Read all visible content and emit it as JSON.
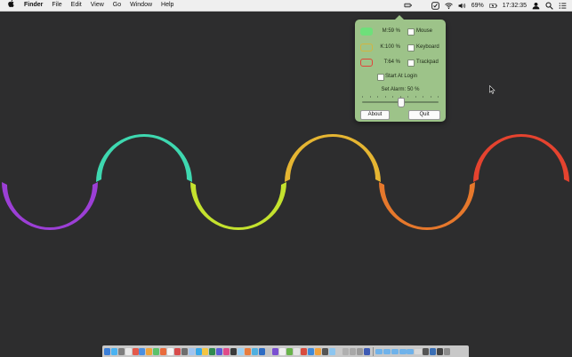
{
  "menubar": {
    "apple_icon": "apple-logo-icon",
    "app_name": "Finder",
    "menus": [
      "File",
      "Edit",
      "View",
      "Go",
      "Window",
      "Help"
    ],
    "status": {
      "icons": [
        "battery-app-icon",
        "checkmark-icon",
        "wifi-icon",
        "volume-icon"
      ],
      "battery_percent": "69%",
      "time": "17:32:35",
      "right_icons": [
        "user-icon",
        "search-icon",
        "list-icon"
      ]
    }
  },
  "popover": {
    "background": "#9dc389",
    "devices": [
      {
        "icon": "mouse-battery-icon",
        "color": "#6ee07a",
        "value": "M:59 %",
        "checkbox_label": "Mouse",
        "checked": false
      },
      {
        "icon": "keyboard-battery-icon",
        "color": "#d2b540",
        "value": "K:100 %",
        "checkbox_label": "Keyboard",
        "checked": false
      },
      {
        "icon": "trackpad-battery-icon",
        "color": "#e0443a",
        "value": "T:64 %",
        "checkbox_label": "Trackpad",
        "checked": false
      }
    ],
    "start_at_login": {
      "label": "Start At Login",
      "checked": false
    },
    "alarm": {
      "label": "Set Alarm: 50 %",
      "value": 0.5
    },
    "buttons": {
      "about": "About",
      "quit": "Quit"
    }
  },
  "wallpaper": {
    "wave_colors": [
      "#9c3fd6",
      "#3ed8b0",
      "#c4e22e",
      "#e5b532",
      "#e6782c",
      "#e5432f"
    ]
  },
  "dock": {
    "icon_colors": [
      "#3b7fd9",
      "#4ab3f2",
      "#7e7e7e",
      "#e9e9e9",
      "#e45a4b",
      "#4a90e2",
      "#f0a33a",
      "#5bc26b",
      "#e96b3c",
      "#f5f5f5",
      "#d84b4b",
      "#6e6e6e",
      "#a0c4f0",
      "#38a8e8",
      "#f4c542",
      "#2f8a4f",
      "#5c5cd6",
      "#e04b8a",
      "#3a3a3a",
      "#9ad1f5",
      "#e87d3e",
      "#4fb0e0",
      "#2d6cc4",
      "#c3c3c3",
      "#7a4fd1",
      "#f0f0f0",
      "#68b34a",
      "#e4e4e4",
      "#d94c3f",
      "#3f8ad9",
      "#f2a23c",
      "#555555",
      "#8dc6f0",
      "#c9c9c9",
      "#b0b0b0",
      "#a8a8a8",
      "#9a9a9a",
      "#3e5bb5"
    ],
    "stack_colors": [
      "#6fb2ea",
      "#6fb2ea",
      "#6fb2ea",
      "#6fb2ea",
      "#6fb2ea",
      "#d8d8d8"
    ],
    "tray_colors": [
      "#555555",
      "#3a6fb5",
      "#444444",
      "#8c8c8c"
    ]
  }
}
